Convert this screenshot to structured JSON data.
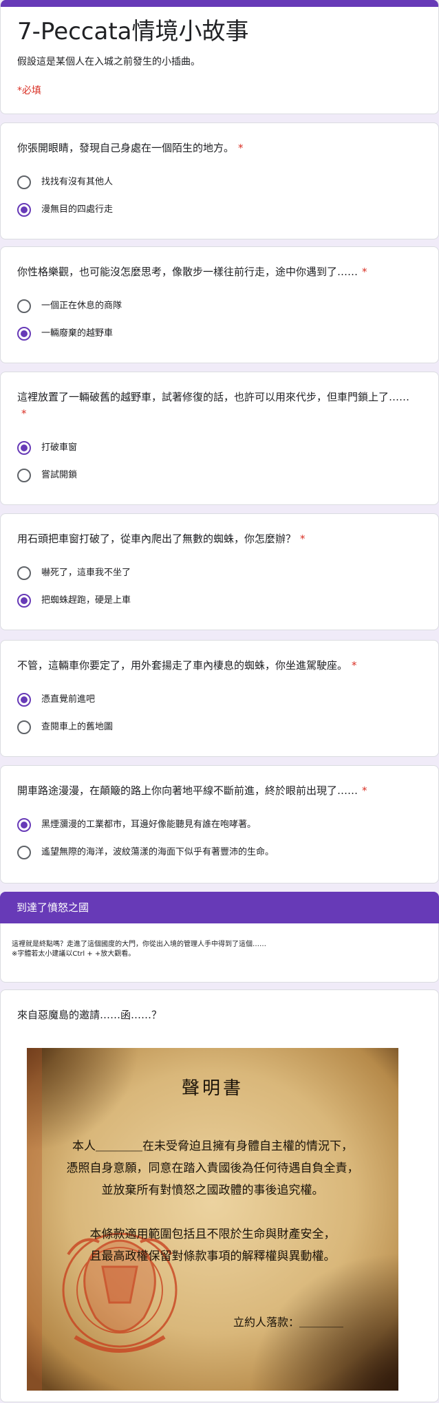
{
  "header": {
    "title": "7-Peccata情境小故事",
    "description": "假設這是某個人在入城之前發生的小插曲。",
    "required_note": "*必填"
  },
  "questions": [
    {
      "title": "你張開眼睛，發現自己身處在一個陌生的地方。",
      "required_mark": "*",
      "options": [
        {
          "label": "找找有沒有其他人",
          "checked": false
        },
        {
          "label": "漫無目的四處行走",
          "checked": true
        }
      ]
    },
    {
      "title": "你性格樂觀，也可能沒怎麼思考，像散步一樣往前行走，途中你遇到了……",
      "required_mark": "*",
      "options": [
        {
          "label": "一個正在休息的商隊",
          "checked": false
        },
        {
          "label": "一輛廢棄的越野車",
          "checked": true
        }
      ]
    },
    {
      "title": "這裡放置了一輛破舊的越野車，試著修復的話，也許可以用來代步，但車門鎖上了……",
      "required_mark": "*",
      "options": [
        {
          "label": "打破車窗",
          "checked": true
        },
        {
          "label": "嘗試開鎖",
          "checked": false
        }
      ]
    },
    {
      "title": "用石頭把車窗打破了，從車內爬出了無數的蜘蛛，你怎麼辦？",
      "required_mark": "*",
      "options": [
        {
          "label": "嚇死了，這車我不坐了",
          "checked": false
        },
        {
          "label": "把蜘蛛趕跑，硬是上車",
          "checked": true
        }
      ]
    },
    {
      "title": "不管，這輛車你要定了，用外套揚走了車內棲息的蜘蛛，你坐進駕駛座。",
      "required_mark": "*",
      "options": [
        {
          "label": "憑直覺前進吧",
          "checked": true
        },
        {
          "label": "查閱車上的舊地圖",
          "checked": false
        }
      ]
    },
    {
      "title": "開車路途漫漫，在顛簸的路上你向著地平線不斷前進，終於眼前出現了……",
      "required_mark": "*",
      "options": [
        {
          "label": "黑煙瀰漫的工業都市，耳邊好像能聽見有誰在咆哮著。",
          "checked": true
        },
        {
          "label": "遙望無際的海洋，波紋蕩漾的海面下似乎有著豐沛的生命。",
          "checked": false
        }
      ]
    }
  ],
  "section": {
    "title": "到達了憤怒之國",
    "description_line1": "這裡就是終點嗎？走進了這個國度的大門，你從出入境的管理人手中得到了這個……",
    "description_line2": "※字體若太小建議以Ctrl + +放大觀看。"
  },
  "image_item": {
    "title": "來自惡魔島的邀請……函……？",
    "document": {
      "heading": "聲明書",
      "line1": "本人＿＿＿＿在未受脅迫且擁有身體自主權的情況下，",
      "line2": "憑照自身意願，同意在踏入貴國後為任何待遇自負全責，",
      "line3": "並放棄所有對憤怒之國政體的事後追究權。",
      "line4": "本條款適用範圍包括且不限於生命與財產安全，",
      "line5": "且最高政權保留對條款事項的解釋權與異動權。",
      "signature": "立約人落款：＿＿＿＿"
    }
  },
  "colors": {
    "accent": "#673ab7",
    "page_bg": "#f0ebf8",
    "required": "#d93025",
    "parchment": "#d9b77a",
    "seal_red": "#c8411f"
  }
}
